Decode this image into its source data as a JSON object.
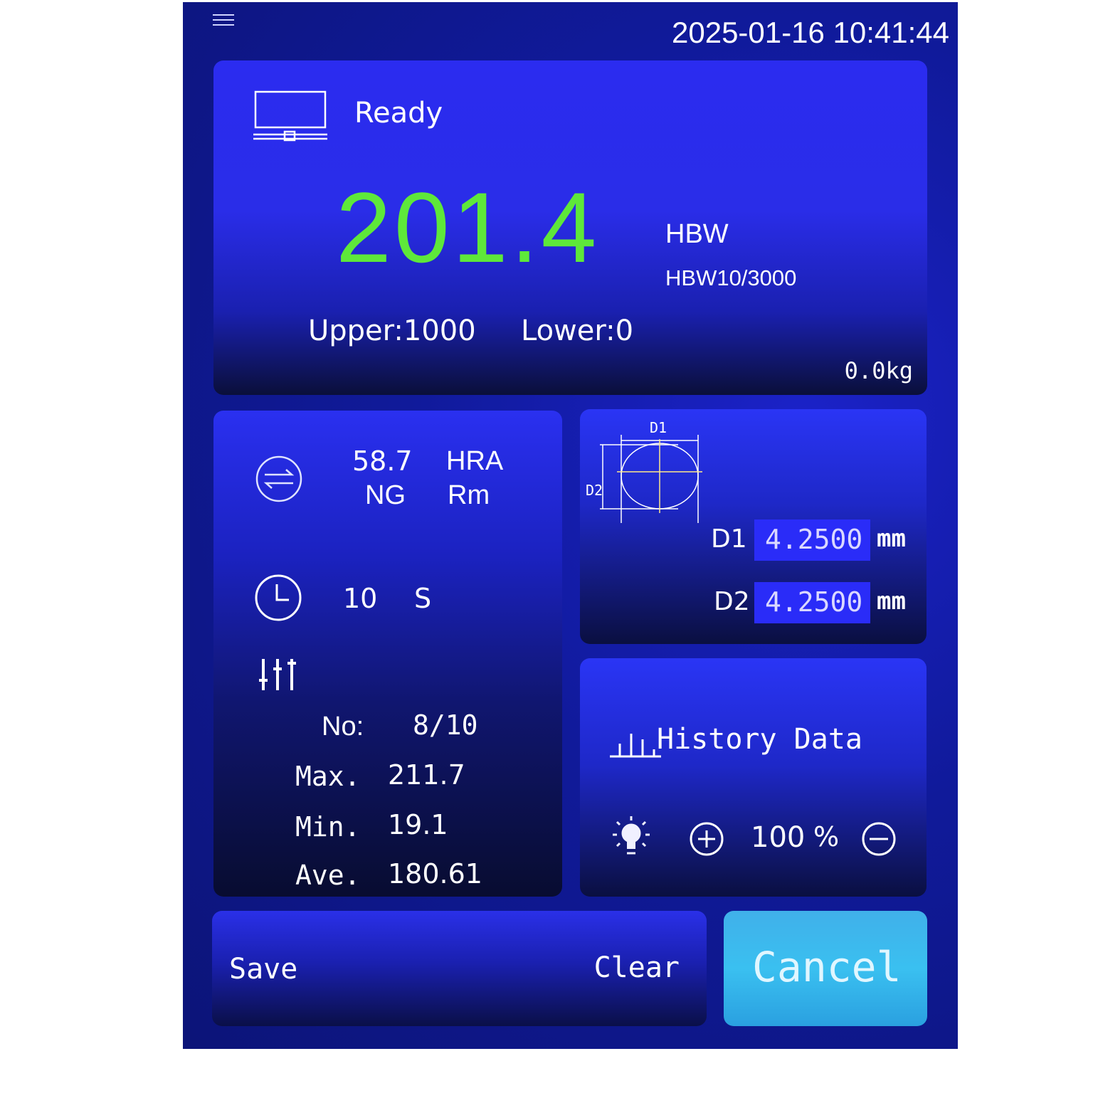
{
  "header": {
    "menu_icon": "menu-icon",
    "datetime": "2025-01-16  10:41:44"
  },
  "main": {
    "status_icon": "monitor-icon",
    "status": "Ready",
    "value": "201.4",
    "value_color": "#5ee83a",
    "unit": "HBW",
    "scale": "HBW10/3000",
    "upper": "Upper:1000",
    "lower": "Lower:0",
    "force": "0.0kg"
  },
  "convert": {
    "icon": "convert-arrows-icon",
    "value": "58.7",
    "scale": "HRA",
    "result": "NG",
    "label": "Rm"
  },
  "dwell": {
    "icon": "clock-icon",
    "value": "10",
    "unit": "S"
  },
  "stats": {
    "icon": "sliders-icon",
    "no_label": "No:",
    "no_value": "8/10",
    "max_label": "Max.",
    "max_value": "211.7",
    "min_label": "Min.",
    "min_value": "19.1",
    "ave_label": "Ave.",
    "ave_value": "180.61"
  },
  "measure": {
    "diagram_d1": "D1",
    "diagram_d2": "D2",
    "d1_label": "D1",
    "d1_value": "4.2500",
    "d2_label": "D2",
    "d2_value": "4.2500",
    "unit": "mm"
  },
  "history": {
    "icon": "bar-chart-icon",
    "label": "History Data"
  },
  "light": {
    "icon": "lightbulb-icon",
    "value": "100",
    "unit": "%"
  },
  "actions": {
    "save": "Save",
    "clear": "Clear",
    "cancel": "Cancel",
    "cancel_color": "#3ab8e8"
  }
}
